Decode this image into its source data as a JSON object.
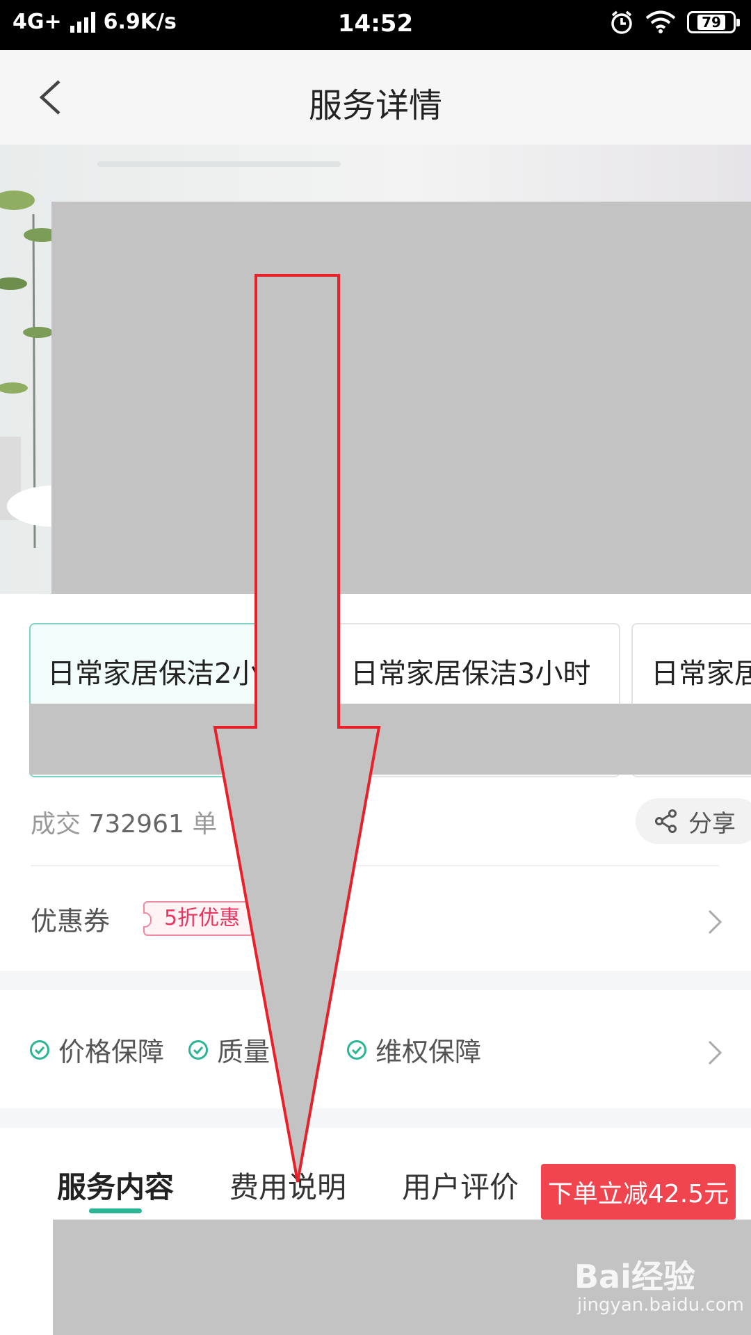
{
  "status_bar": {
    "network": "4G+",
    "speed": "6.9K/s",
    "time": "14:52",
    "battery": "79"
  },
  "nav": {
    "title": "服务详情",
    "back_icon": "chevron-left-icon"
  },
  "packages": [
    {
      "label": "日常家居保洁2小",
      "selected": true
    },
    {
      "label": "日常家居保洁3小时",
      "selected": false
    },
    {
      "label": "日常家居",
      "selected": false
    }
  ],
  "deals": {
    "prefix": "成交",
    "count": "732961",
    "suffix": "单"
  },
  "share": {
    "label": "分享",
    "icon": "share-icon"
  },
  "coupon": {
    "label": "优惠券",
    "tag": "5折优惠"
  },
  "guarantees": [
    "价格保障",
    "质量",
    "维权保障"
  ],
  "tabs": [
    {
      "label": "服务内容",
      "active": true
    },
    {
      "label": "费用说明",
      "active": false
    },
    {
      "label": "用户评价",
      "active": false
    }
  ],
  "promo": {
    "label": "下单立减42.5元"
  },
  "watermark": {
    "logo": "Bai经验",
    "site": "jingyan.baidu.com"
  },
  "colors": {
    "accent": "#2bb594",
    "promo": "#f0454f",
    "coupon": "#e8365e",
    "arrow": "#e8202a",
    "redaction": "#c3c3c3"
  }
}
